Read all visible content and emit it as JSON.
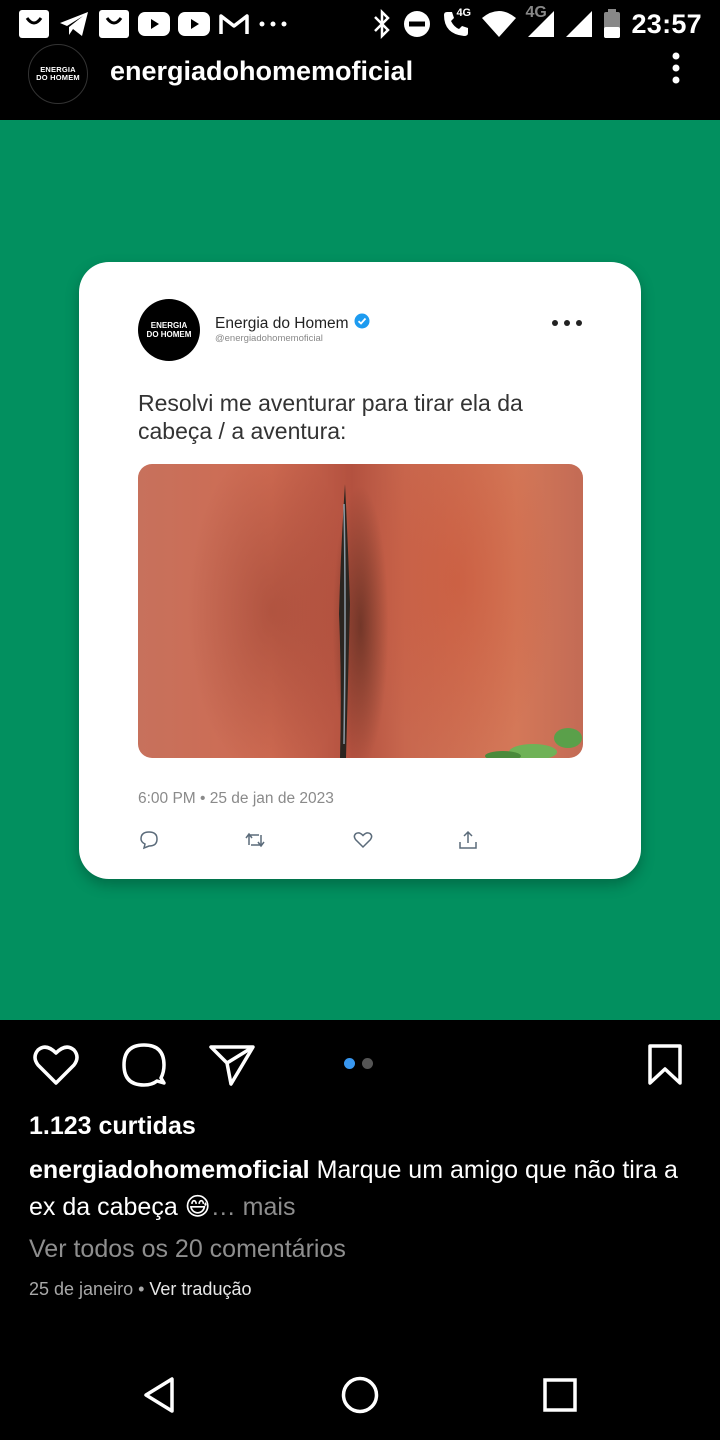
{
  "status_bar": {
    "time": "23:57",
    "network_label": "4G",
    "volte_label": "4G",
    "icons": [
      "shopping-bag-icon",
      "telegram-icon",
      "shopping-bag-icon",
      "youtube-icon",
      "youtube-icon",
      "gmail-icon",
      "more-notifications-icon",
      "bluetooth-icon",
      "do-not-disturb-icon",
      "volte-call-icon",
      "wifi-icon",
      "signal-icon",
      "signal-icon",
      "battery-icon"
    ]
  },
  "post": {
    "account_avatar_lines": [
      "ENERGIA",
      "DO HOMEM"
    ],
    "username": "energiadohomemoficial"
  },
  "tweet": {
    "avatar_lines": [
      "ENERGIA",
      "DO HOMEM"
    ],
    "display_name": "Energia do Homem",
    "handle": "@energiadohomemoficial",
    "verified": true,
    "text": "Resolvi me aventurar para tirar ela da cabeça / a aventura:",
    "timestamp": "6:00 PM • 25 de jan de 2023",
    "background_color": "#02905f",
    "verified_color": "#1d9bf0"
  },
  "actions": {
    "carousel": {
      "total": 2,
      "active": 1
    },
    "active_dot_color": "#3897f0"
  },
  "likes": "1.123 curtidas",
  "caption": {
    "username": "energiadohomemoficial",
    "text": "Marque um amigo que não tira a ex da cabeça",
    "emoji": "😅",
    "more": "… mais"
  },
  "comments_link": "Ver todos os 20 comentários",
  "meta": {
    "date": "25 de janeiro",
    "separator": " • ",
    "translate": "Ver tradução"
  }
}
